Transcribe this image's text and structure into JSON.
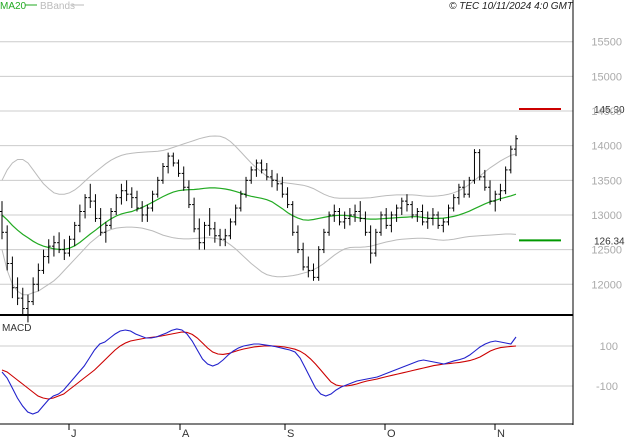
{
  "header": {
    "ma_label": "MA20",
    "bb_label": "BBands",
    "source": "© TEC 10/11/2024 4:0 GMT"
  },
  "colors": {
    "ma": "#22aa22",
    "bbands": "#bbbbbb",
    "bars": "#000000",
    "resistance": "#cc0000",
    "support": "#009900",
    "macd": "#2222cc",
    "signal": "#cc0000",
    "grid": "#cccccc"
  },
  "chart_data": [
    {
      "type": "ohlc",
      "price_axis": {
        "ticks": [
          12000,
          12500,
          13000,
          13500,
          14000,
          14500,
          15000,
          15500
        ],
        "labels": [
          "12000",
          "12500",
          "13000",
          "13500",
          "14000",
          "14500",
          "15000",
          "15500"
        ],
        "ylim": [
          11600,
          15900
        ]
      },
      "x_axis": {
        "labels": [
          "J",
          "A",
          "S",
          "O",
          "N"
        ]
      },
      "series": [
        {
          "name": "MA20",
          "values": [
            13000,
            12930,
            12850,
            12780,
            12720,
            12670,
            12620,
            12580,
            12550,
            12530,
            12510,
            12505,
            12505,
            12520,
            12555,
            12605,
            12665,
            12725,
            12780,
            12840,
            12895,
            12945,
            12985,
            13015,
            13035,
            13050,
            13080,
            13110,
            13145,
            13185,
            13225,
            13265,
            13300,
            13330,
            13350,
            13360,
            13365,
            13368,
            13375,
            13385,
            13390,
            13390,
            13385,
            13375,
            13360,
            13340,
            13315,
            13290,
            13270,
            13255,
            13240,
            13220,
            13190,
            13140,
            13090,
            13035,
            12990,
            12955,
            12930,
            12925,
            12935,
            12950,
            12965,
            12980,
            12990,
            12995,
            12995,
            12985,
            12970,
            12955,
            12945,
            12940,
            12940,
            12945,
            12950,
            12955,
            12960,
            12965,
            12970,
            12975,
            12975,
            12965,
            12955,
            12950,
            12950,
            12955,
            12965,
            12980,
            13000,
            13025,
            13055,
            13090,
            13125,
            13160,
            13190,
            13210,
            13235,
            13255,
            13275,
            13300
          ]
        },
        {
          "name": "BB upper",
          "values": [
            13500,
            13650,
            13750,
            13800,
            13800,
            13750,
            13650,
            13550,
            13450,
            13380,
            13320,
            13300,
            13300,
            13320,
            13360,
            13420,
            13490,
            13560,
            13620,
            13680,
            13740,
            13790,
            13830,
            13860,
            13880,
            13890,
            13900,
            13905,
            13910,
            13915,
            13920,
            13930,
            13950,
            13975,
            14000,
            14025,
            14050,
            14075,
            14100,
            14120,
            14135,
            14140,
            14135,
            14110,
            14060,
            13990,
            13910,
            13830,
            13750,
            13680,
            13620,
            13560,
            13520,
            13490,
            13470,
            13460,
            13450,
            13440,
            13430,
            13410,
            13380,
            13340,
            13300,
            13270,
            13250,
            13240,
            13240,
            13240,
            13240,
            13240,
            13245,
            13250,
            13260,
            13270,
            13280,
            13285,
            13290,
            13290,
            13290,
            13290,
            13285,
            13275,
            13270,
            13270,
            13275,
            13285,
            13300,
            13320,
            13350,
            13390,
            13440,
            13500,
            13560,
            13620,
            13680,
            13730,
            13780,
            13820,
            13860,
            13880
          ]
        },
        {
          "name": "BB lower",
          "values": [
            12500,
            12200,
            12000,
            11900,
            11850,
            11850,
            11880,
            11900,
            11950,
            12000,
            12050,
            12120,
            12200,
            12280,
            12360,
            12440,
            12520,
            12600,
            12660,
            12720,
            12760,
            12790,
            12810,
            12820,
            12825,
            12825,
            12820,
            12810,
            12790,
            12770,
            12740,
            12710,
            12690,
            12670,
            12660,
            12655,
            12655,
            12660,
            12665,
            12670,
            12670,
            12665,
            12650,
            12620,
            12570,
            12510,
            12440,
            12370,
            12300,
            12240,
            12180,
            12140,
            12120,
            12110,
            12110,
            12115,
            12125,
            12140,
            12160,
            12180,
            12210,
            12250,
            12300,
            12360,
            12420,
            12470,
            12510,
            12530,
            12535,
            12535,
            12540,
            12550,
            12570,
            12590,
            12610,
            12625,
            12640,
            12650,
            12655,
            12660,
            12665,
            12665,
            12660,
            12650,
            12640,
            12635,
            12640,
            12650,
            12665,
            12680,
            12690,
            12695,
            12700,
            12705,
            12710,
            12715,
            12720,
            12725,
            12725,
            12720
          ]
        }
      ],
      "levels": [
        {
          "value": 14530,
          "label": "145.30"
        },
        {
          "value": 12634,
          "label": "126.34"
        }
      ],
      "ohlc": [
        [
          13050,
          13200,
          12650,
          12750
        ],
        [
          12750,
          12850,
          12200,
          12300
        ],
        [
          12300,
          12400,
          11800,
          11950
        ],
        [
          11950,
          12100,
          11700,
          11800
        ],
        [
          11800,
          11950,
          11550,
          11650
        ],
        [
          11650,
          11850,
          11450,
          11750
        ],
        [
          11750,
          12100,
          11700,
          12000
        ],
        [
          12000,
          12300,
          11900,
          12200
        ],
        [
          12200,
          12500,
          12150,
          12400
        ],
        [
          12400,
          12650,
          12300,
          12550
        ],
        [
          12550,
          12700,
          12400,
          12600
        ],
        [
          12600,
          12750,
          12450,
          12500
        ],
        [
          12500,
          12650,
          12350,
          12450
        ],
        [
          12450,
          12700,
          12400,
          12650
        ],
        [
          12650,
          12900,
          12550,
          12850
        ],
        [
          12850,
          13150,
          12750,
          13050
        ],
        [
          13050,
          13300,
          12950,
          13250
        ],
        [
          13250,
          13450,
          13100,
          13200
        ],
        [
          13200,
          13300,
          12900,
          12950
        ],
        [
          12950,
          13100,
          12700,
          12750
        ],
        [
          12750,
          12900,
          12600,
          12850
        ],
        [
          12850,
          13100,
          12800,
          13050
        ],
        [
          13050,
          13300,
          13000,
          13250
        ],
        [
          13250,
          13450,
          13150,
          13350
        ],
        [
          13350,
          13500,
          13200,
          13300
        ],
        [
          13300,
          13400,
          13100,
          13250
        ],
        [
          13250,
          13350,
          13050,
          13100
        ],
        [
          13100,
          13200,
          12900,
          13000
        ],
        [
          13000,
          13150,
          12900,
          13100
        ],
        [
          13100,
          13350,
          13050,
          13300
        ],
        [
          13300,
          13550,
          13250,
          13500
        ],
        [
          13500,
          13750,
          13450,
          13700
        ],
        [
          13700,
          13900,
          13600,
          13850
        ],
        [
          13850,
          13900,
          13700,
          13750
        ],
        [
          13750,
          13800,
          13550,
          13600
        ],
        [
          13600,
          13700,
          13350,
          13400
        ],
        [
          13400,
          13500,
          13100,
          13150
        ],
        [
          13150,
          13250,
          12750,
          12800
        ],
        [
          12800,
          12950,
          12500,
          12600
        ],
        [
          12600,
          12900,
          12500,
          12850
        ],
        [
          12850,
          13100,
          12700,
          12800
        ],
        [
          12800,
          12900,
          12600,
          12700
        ],
        [
          12700,
          12800,
          12550,
          12650
        ],
        [
          12650,
          12800,
          12550,
          12700
        ],
        [
          12700,
          12950,
          12650,
          12900
        ],
        [
          12900,
          13150,
          12850,
          13100
        ],
        [
          13100,
          13350,
          13050,
          13300
        ],
        [
          13300,
          13550,
          13250,
          13500
        ],
        [
          13500,
          13700,
          13450,
          13650
        ],
        [
          13650,
          13800,
          13550,
          13750
        ],
        [
          13750,
          13800,
          13600,
          13650
        ],
        [
          13650,
          13750,
          13500,
          13550
        ],
        [
          13550,
          13650,
          13400,
          13500
        ],
        [
          13500,
          13600,
          13350,
          13450
        ],
        [
          13450,
          13550,
          13250,
          13300
        ],
        [
          13300,
          13400,
          13100,
          13150
        ],
        [
          13150,
          13200,
          12700,
          12750
        ],
        [
          12750,
          12850,
          12450,
          12500
        ],
        [
          12500,
          12600,
          12200,
          12250
        ],
        [
          12250,
          12400,
          12100,
          12200
        ],
        [
          12200,
          12300,
          12050,
          12100
        ],
        [
          12100,
          12550,
          12050,
          12500
        ],
        [
          12500,
          12800,
          12450,
          12750
        ],
        [
          12750,
          13050,
          12700,
          13000
        ],
        [
          13000,
          13150,
          12900,
          13050
        ],
        [
          13050,
          13100,
          12850,
          12900
        ],
        [
          12900,
          13050,
          12800,
          12950
        ],
        [
          12950,
          13100,
          12850,
          13000
        ],
        [
          13000,
          13150,
          12900,
          13050
        ],
        [
          13050,
          13200,
          12900,
          12950
        ],
        [
          12950,
          13050,
          12700,
          12750
        ],
        [
          12750,
          12850,
          12300,
          12450
        ],
        [
          12450,
          12800,
          12400,
          12750
        ],
        [
          12750,
          13050,
          12700,
          13000
        ],
        [
          13000,
          13100,
          12800,
          12850
        ],
        [
          12850,
          13050,
          12750,
          13000
        ],
        [
          13000,
          13150,
          12900,
          13100
        ],
        [
          13100,
          13250,
          13000,
          13200
        ],
        [
          13200,
          13300,
          13050,
          13150
        ],
        [
          13150,
          13200,
          12950,
          13000
        ],
        [
          13000,
          13100,
          12900,
          13050
        ],
        [
          13050,
          13150,
          12850,
          12900
        ],
        [
          12900,
          13050,
          12800,
          12950
        ],
        [
          12950,
          13100,
          12850,
          13000
        ],
        [
          13000,
          13050,
          12800,
          12850
        ],
        [
          12850,
          12950,
          12750,
          12900
        ],
        [
          12900,
          13150,
          12850,
          13100
        ],
        [
          13100,
          13300,
          13050,
          13250
        ],
        [
          13250,
          13450,
          13150,
          13400
        ],
        [
          13400,
          13500,
          13250,
          13300
        ],
        [
          13300,
          13550,
          13250,
          13500
        ],
        [
          13500,
          13950,
          13450,
          13900
        ],
        [
          13900,
          13950,
          13500,
          13550
        ],
        [
          13550,
          13650,
          13350,
          13400
        ],
        [
          13400,
          13500,
          13150,
          13200
        ],
        [
          13200,
          13350,
          13050,
          13300
        ],
        [
          13300,
          13450,
          13200,
          13350
        ],
        [
          13350,
          13700,
          13300,
          13650
        ],
        [
          13650,
          14000,
          13600,
          13950
        ],
        [
          13950,
          14150,
          13850,
          14100
        ]
      ]
    },
    {
      "type": "line",
      "title": "MACD",
      "y_axis": {
        "ticks": [
          100,
          -100
        ],
        "labels": [
          "100",
          "-100"
        ],
        "ylim": [
          -280,
          230
        ]
      },
      "series": [
        {
          "name": "MACD",
          "values": [
            -30,
            -60,
            -110,
            -160,
            -200,
            -230,
            -240,
            -230,
            -200,
            -170,
            -150,
            -140,
            -120,
            -90,
            -60,
            -30,
            0,
            40,
            80,
            110,
            120,
            140,
            160,
            175,
            180,
            175,
            160,
            150,
            140,
            140,
            145,
            155,
            165,
            178,
            185,
            180,
            160,
            125,
            80,
            35,
            10,
            0,
            10,
            30,
            55,
            75,
            90,
            100,
            105,
            110,
            110,
            106,
            102,
            98,
            92,
            86,
            80,
            70,
            40,
            -10,
            -60,
            -110,
            -140,
            -150,
            -140,
            -120,
            -105,
            -95,
            -85,
            -75,
            -70,
            -65,
            -60,
            -55,
            -45,
            -35,
            -25,
            -15,
            -5,
            5,
            15,
            25,
            30,
            25,
            20,
            15,
            10,
            18,
            26,
            32,
            40,
            55,
            75,
            95,
            110,
            120,
            125,
            120,
            115,
            110,
            145
          ]
        },
        {
          "name": "Signal",
          "values": [
            -20,
            -30,
            -50,
            -70,
            -90,
            -110,
            -130,
            -150,
            -160,
            -165,
            -160,
            -150,
            -140,
            -120,
            -100,
            -80,
            -60,
            -40,
            -20,
            5,
            30,
            55,
            80,
            100,
            115,
            125,
            130,
            135,
            140,
            143,
            146,
            150,
            155,
            160,
            165,
            170,
            168,
            158,
            140,
            115,
            90,
            70,
            60,
            58,
            62,
            70,
            78,
            85,
            90,
            95,
            98,
            100,
            101,
            100,
            98,
            95,
            90,
            84,
            74,
            58,
            36,
            10,
            -20,
            -50,
            -80,
            -95,
            -100,
            -100,
            -96,
            -90,
            -82,
            -75,
            -70,
            -65,
            -58,
            -52,
            -46,
            -40,
            -34,
            -28,
            -22,
            -16,
            -10,
            -4,
            2,
            6,
            10,
            12,
            15,
            18,
            22,
            27,
            35,
            45,
            60,
            75,
            85,
            92,
            95,
            98,
            100
          ]
        }
      ]
    }
  ]
}
